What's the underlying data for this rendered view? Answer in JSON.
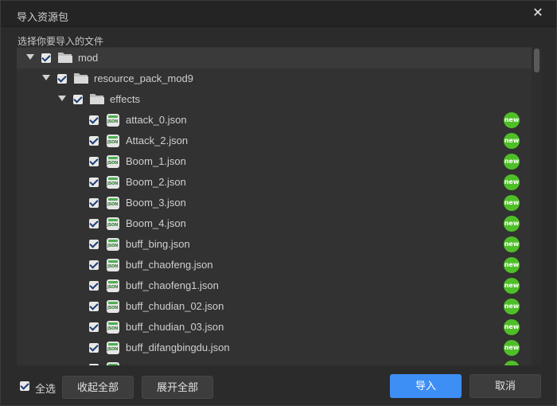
{
  "dialog": {
    "title": "导入资源包",
    "close_symbol": "✕",
    "subtitle": "选择你要导入的文件"
  },
  "tree": {
    "folders": [
      {
        "label": "mod",
        "checked": true,
        "expanded": true
      },
      {
        "label": "resource_pack_mod9",
        "checked": true,
        "expanded": true
      },
      {
        "label": "effects",
        "checked": true,
        "expanded": true
      }
    ],
    "file_icon": "JSON",
    "badge_text": "new",
    "files": [
      {
        "label": "attack_0.json",
        "checked": true,
        "badge": "new"
      },
      {
        "label": "Attack_2.json",
        "checked": true,
        "badge": "new"
      },
      {
        "label": "Boom_1.json",
        "checked": true,
        "badge": "new"
      },
      {
        "label": "Boom_2.json",
        "checked": true,
        "badge": "new"
      },
      {
        "label": "Boom_3.json",
        "checked": true,
        "badge": "new"
      },
      {
        "label": "Boom_4.json",
        "checked": true,
        "badge": "new"
      },
      {
        "label": "buff_bing.json",
        "checked": true,
        "badge": "new"
      },
      {
        "label": "buff_chaofeng.json",
        "checked": true,
        "badge": "new"
      },
      {
        "label": "buff_chaofeng1.json",
        "checked": true,
        "badge": "new"
      },
      {
        "label": "buff_chudian_02.json",
        "checked": true,
        "badge": "new"
      },
      {
        "label": "buff_chudian_03.json",
        "checked": true,
        "badge": "new"
      },
      {
        "label": "buff_difangbingdu.json",
        "checked": true,
        "badge": "new"
      }
    ]
  },
  "footer": {
    "select_all_label": "全选",
    "select_all_checked": true,
    "collapse_all_label": "收起全部",
    "expand_all_label": "展开全部",
    "import_label": "导入",
    "cancel_label": "取消"
  },
  "colors": {
    "accent": "#3d8ff5",
    "badge": "#4fbf28",
    "background": "#2b2b2b"
  }
}
